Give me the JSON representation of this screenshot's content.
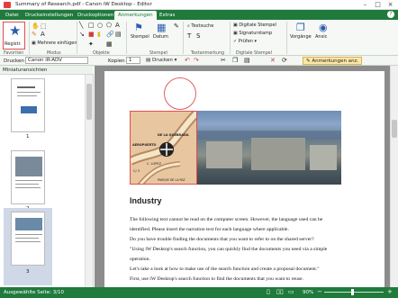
{
  "window": {
    "title": "Summary of Research.pdf - Canon iW Desktop - Editor"
  },
  "tabs": [
    "Datei",
    "Druckeinstellungen",
    "Druckoptionen",
    "Anmerkungen",
    "Extras"
  ],
  "ribbon": {
    "register": "Registr.",
    "insert_multiple": "Mehrere einfügen",
    "stamp": "Stempel",
    "date": "Datum",
    "textbox": "Textsuche",
    "digital_stamp": "Digitale Stempel",
    "signature_stamp": "Signaturstamp",
    "check": "Prüfen",
    "preview": "Vorgänge",
    "view": "Ansic",
    "groups": [
      "Favoriten",
      "Modus",
      "Objekte",
      "Stempel",
      "Textanmerkung",
      "Digitale Stempel"
    ]
  },
  "toolbar": {
    "print_label": "Drucken",
    "printer": "Canon iR-ADV",
    "copies_label": "Kopien",
    "copies": "1",
    "print_btn": "Drucken",
    "annotations_btn": "Anmerkungen anz."
  },
  "thumbnails": {
    "header": "Miniaturansichten",
    "pages": [
      "1",
      "2",
      "3"
    ]
  },
  "document": {
    "heading": "Industry",
    "map_labels": [
      "DE LA QUEBRADA",
      "AEROPUERTO",
      "CALLE NUEVA",
      "PARQUE DE LA PAZ",
      "C. LOPEZ",
      "BARR",
      "PLAZA",
      "NUEVA",
      "C/ 3"
    ],
    "lines": [
      "The following text cannot be read on the computer screen. However, the language used can be",
      "identified. Please insert the narration text for each language where applicable.",
      "Do you have trouble finding the documents that you want to refer to on the shared server?",
      "\"Using iW Desktop's search function, you can quickly find the documents you need via a simple",
      "operation.",
      "Let's take a look at how to make use of the search function and create a proposal document.\"",
      "First, use iW Desktop's search function to find the documents that you want to reuse."
    ]
  },
  "status": {
    "left": "Ausgewählte Seite: 3/10",
    "zoom": "90%"
  },
  "colors": {
    "accent": "#1f7a3c",
    "selection": "#e05050"
  }
}
